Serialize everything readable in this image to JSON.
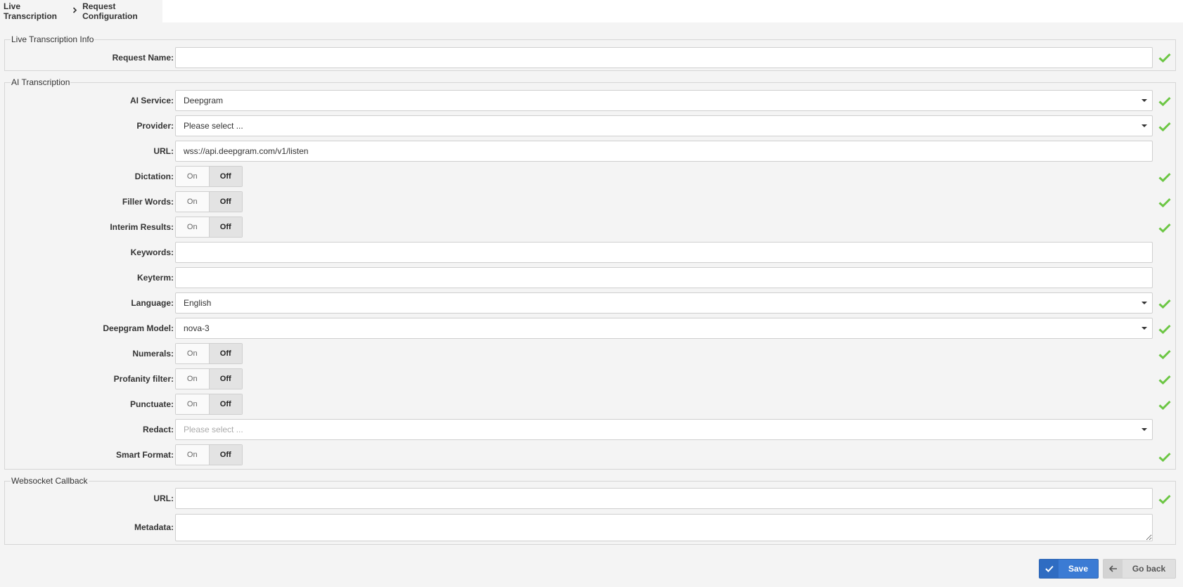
{
  "breadcrumb": {
    "root": "Live Transcription",
    "current": "Request Configuration"
  },
  "sections": {
    "info": {
      "legend": "Live Transcription Info",
      "request_name_label": "Request Name:",
      "request_name_value": ""
    },
    "ai": {
      "legend": "AI Transcription",
      "ai_service_label": "AI Service:",
      "ai_service_value": "Deepgram",
      "provider_label": "Provider:",
      "provider_value": "Please select ...",
      "url_label": "URL:",
      "url_value": "wss://api.deepgram.com/v1/listen",
      "dictation_label": "Dictation:",
      "filler_label": "Filler Words:",
      "interim_label": "Interim Results:",
      "keywords_label": "Keywords:",
      "keywords_value": "",
      "keyterm_label": "Keyterm:",
      "keyterm_value": "",
      "language_label": "Language:",
      "language_value": "English",
      "model_label": "Deepgram Model:",
      "model_value": "nova-3",
      "numerals_label": "Numerals:",
      "profanity_label": "Profanity filter:",
      "punctuate_label": "Punctuate:",
      "redact_label": "Redact:",
      "redact_placeholder": "Please select ...",
      "smart_label": "Smart Format:"
    },
    "websocket": {
      "legend": "Websocket Callback",
      "url_label": "URL:",
      "url_value": "",
      "metadata_label": "Metadata:",
      "metadata_value": ""
    }
  },
  "toggle": {
    "on": "On",
    "off": "Off",
    "state": "Off"
  },
  "buttons": {
    "save": "Save",
    "back": "Go back"
  },
  "colors": {
    "accent": "#3b7bd4",
    "check": "#6cc644"
  },
  "icons": {
    "valid": "check-icon",
    "save": "check-icon",
    "back": "arrow-left-icon",
    "select": "caret-down-icon",
    "breadcrumb_sep": "chevron-right-icon"
  }
}
